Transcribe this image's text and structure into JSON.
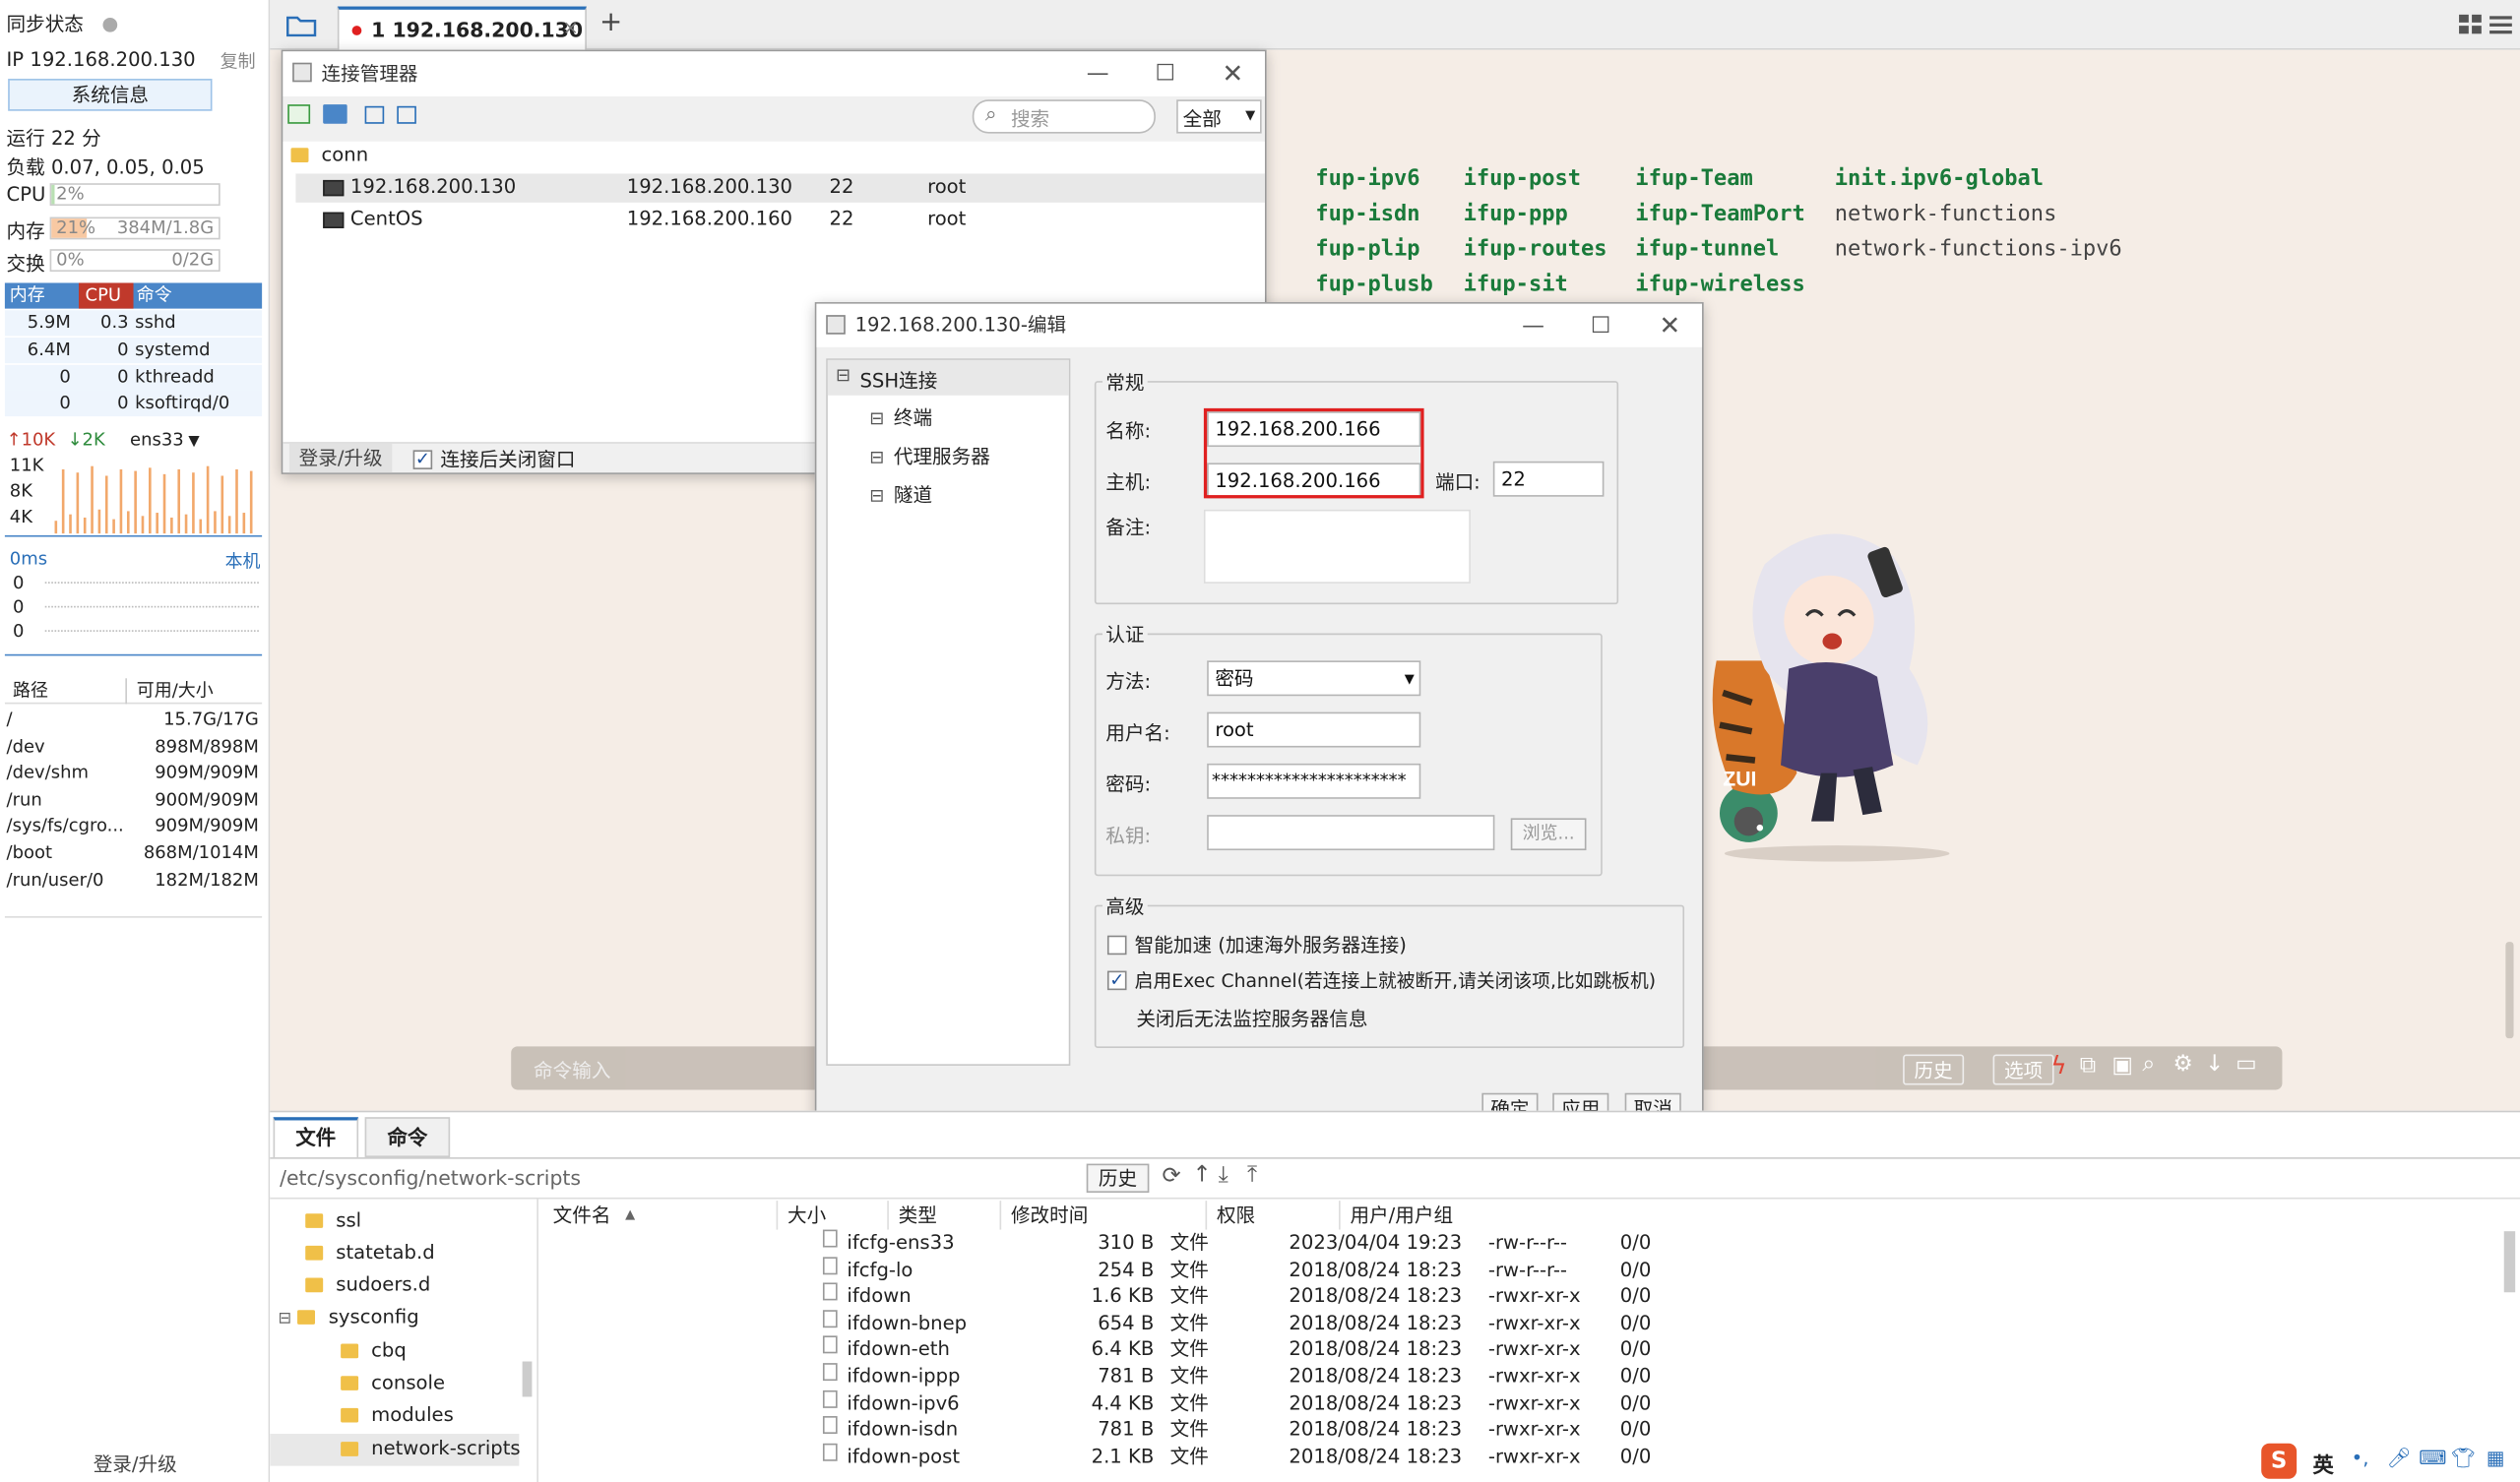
{
  "sidebar": {
    "sync_status": "同步状态",
    "ip_label": "IP 192.168.200.130",
    "copy": "复制",
    "sysinfo_button": "系统信息",
    "uptime": "运行 22 分",
    "load": "负载 0.07, 0.05, 0.05",
    "cpu_label": "CPU",
    "cpu_value": "2%",
    "cpu_percent": 2,
    "mem_label": "内存",
    "mem_pct": "21%",
    "mem_percent": 21,
    "mem_size": "384M/1.8G",
    "swap_label": "交换",
    "swap_pct": "0%",
    "swap_size": "0/2G",
    "proc_headers": [
      "内存",
      "CPU",
      "命令"
    ],
    "processes": [
      {
        "mem": "5.9M",
        "cpu": "0.3",
        "cmd": "sshd"
      },
      {
        "mem": "6.4M",
        "cpu": "0",
        "cmd": "systemd"
      },
      {
        "mem": "0",
        "cpu": "0",
        "cmd": "kthreadd"
      },
      {
        "mem": "0",
        "cpu": "0",
        "cmd": "ksoftirqd/0"
      }
    ],
    "net_up": "10K",
    "net_down": "2K",
    "net_iface": "ens33",
    "net_ticks": [
      "11K",
      "8K",
      "4K"
    ],
    "latency_ms": "0ms",
    "latency_host": "本机",
    "latency_ticks": [
      "0",
      "0",
      "0"
    ],
    "fs_headers": [
      "路径",
      "可用/大小"
    ],
    "filesystems": [
      {
        "path": "/",
        "size": "15.7G/17G"
      },
      {
        "path": "/dev",
        "size": "898M/898M"
      },
      {
        "path": "/dev/shm",
        "size": "909M/909M"
      },
      {
        "path": "/run",
        "size": "900M/909M"
      },
      {
        "path": "/sys/fs/cgro...",
        "size": "909M/909M"
      },
      {
        "path": "/boot",
        "size": "868M/1014M"
      },
      {
        "path": "/run/user/0",
        "size": "182M/182M"
      }
    ],
    "login_upgrade": "登录/升级"
  },
  "tabs": {
    "active_tab": "1 192.168.200.130",
    "add": "+"
  },
  "terminal": {
    "rows": [
      [
        "fup-ipv6",
        "ifup-post",
        "ifup-Team",
        "init.ipv6-global"
      ],
      [
        "fup-isdn",
        "ifup-ppp",
        "ifup-TeamPort",
        "network-functions"
      ],
      [
        "fup-plip",
        "ifup-routes",
        "ifup-tunnel",
        "network-functions-ipv6"
      ],
      [
        "fup-plusb",
        "ifup-sit",
        "ifup-wireless",
        ""
      ]
    ],
    "command_placeholder": "命令输入",
    "history_btn": "历史",
    "options_btn": "选项"
  },
  "conn_manager": {
    "title": "连接管理器",
    "search_placeholder": "搜索",
    "filter": "全部",
    "folder": "conn",
    "items": [
      {
        "name": "192.168.200.130",
        "host": "192.168.200.130",
        "port": "22",
        "user": "root"
      },
      {
        "name": "CentOS",
        "host": "192.168.200.160",
        "port": "22",
        "user": "root"
      }
    ],
    "login_upgrade": "登录/升级",
    "close_after_connect": "连接后关闭窗口"
  },
  "edit_dialog": {
    "title": "192.168.200.130-编辑",
    "tree": [
      "SSH连接",
      "终端",
      "代理服务器",
      "隧道"
    ],
    "general_group": "常规",
    "name_label": "名称:",
    "name_value": "192.168.200.166",
    "host_label": "主机:",
    "host_value": "192.168.200.166",
    "port_label": "端口:",
    "port_value": "22",
    "note_label": "备注:",
    "auth_group": "认证",
    "method_label": "方法:",
    "method_value": "密码",
    "user_label": "用户名:",
    "user_value": "root",
    "pass_label": "密码:",
    "pass_value": "**********************",
    "key_label": "私钥:",
    "browse": "浏览...",
    "advanced_group": "高级",
    "smart_accel": "智能加速 (加速海外服务器连接)",
    "exec_channel": "启用Exec Channel(若连接上就被断开,请关闭该项,比如跳板机)",
    "exec_note": "关闭后无法监控服务器信息",
    "ok": "确定",
    "apply": "应用",
    "cancel": "取消"
  },
  "file_panel": {
    "tab_files": "文件",
    "tab_commands": "命令",
    "path": "/etc/sysconfig/network-scripts",
    "history_btn": "历史",
    "tree": [
      "ssl",
      "statetab.d",
      "sudoers.d",
      "sysconfig",
      "cbq",
      "console",
      "modules",
      "network-scripts"
    ],
    "headers": [
      "文件名",
      "大小",
      "类型",
      "修改时间",
      "权限",
      "用户/用户组"
    ],
    "files": [
      {
        "name": "ifcfg-ens33",
        "size": "310 B",
        "type": "文件",
        "mtime": "2023/04/04 19:23",
        "perm": "-rw-r--r--",
        "owner": "0/0"
      },
      {
        "name": "ifcfg-lo",
        "size": "254 B",
        "type": "文件",
        "mtime": "2018/08/24 18:23",
        "perm": "-rw-r--r--",
        "owner": "0/0"
      },
      {
        "name": "ifdown",
        "size": "1.6 KB",
        "type": "文件",
        "mtime": "2018/08/24 18:23",
        "perm": "-rwxr-xr-x",
        "owner": "0/0"
      },
      {
        "name": "ifdown-bnep",
        "size": "654 B",
        "type": "文件",
        "mtime": "2018/08/24 18:23",
        "perm": "-rwxr-xr-x",
        "owner": "0/0"
      },
      {
        "name": "ifdown-eth",
        "size": "6.4 KB",
        "type": "文件",
        "mtime": "2018/08/24 18:23",
        "perm": "-rwxr-xr-x",
        "owner": "0/0"
      },
      {
        "name": "ifdown-ippp",
        "size": "781 B",
        "type": "文件",
        "mtime": "2018/08/24 18:23",
        "perm": "-rwxr-xr-x",
        "owner": "0/0"
      },
      {
        "name": "ifdown-ipv6",
        "size": "4.4 KB",
        "type": "文件",
        "mtime": "2018/08/24 18:23",
        "perm": "-rwxr-xr-x",
        "owner": "0/0"
      },
      {
        "name": "ifdown-isdn",
        "size": "781 B",
        "type": "文件",
        "mtime": "2018/08/24 18:23",
        "perm": "-rwxr-xr-x",
        "owner": "0/0"
      },
      {
        "name": "ifdown-post",
        "size": "2.1 KB",
        "type": "文件",
        "mtime": "2018/08/24 18:23",
        "perm": "-rwxr-xr-x",
        "owner": "0/0"
      }
    ]
  },
  "ime": {
    "lang": "英"
  },
  "colors": {
    "accent_blue": "#4a86c8",
    "cpu_red": "#c0392b",
    "highlight_red": "#e02020",
    "terminal_green": "#1a7a3a",
    "terminal_bg": "#f5ede6"
  }
}
